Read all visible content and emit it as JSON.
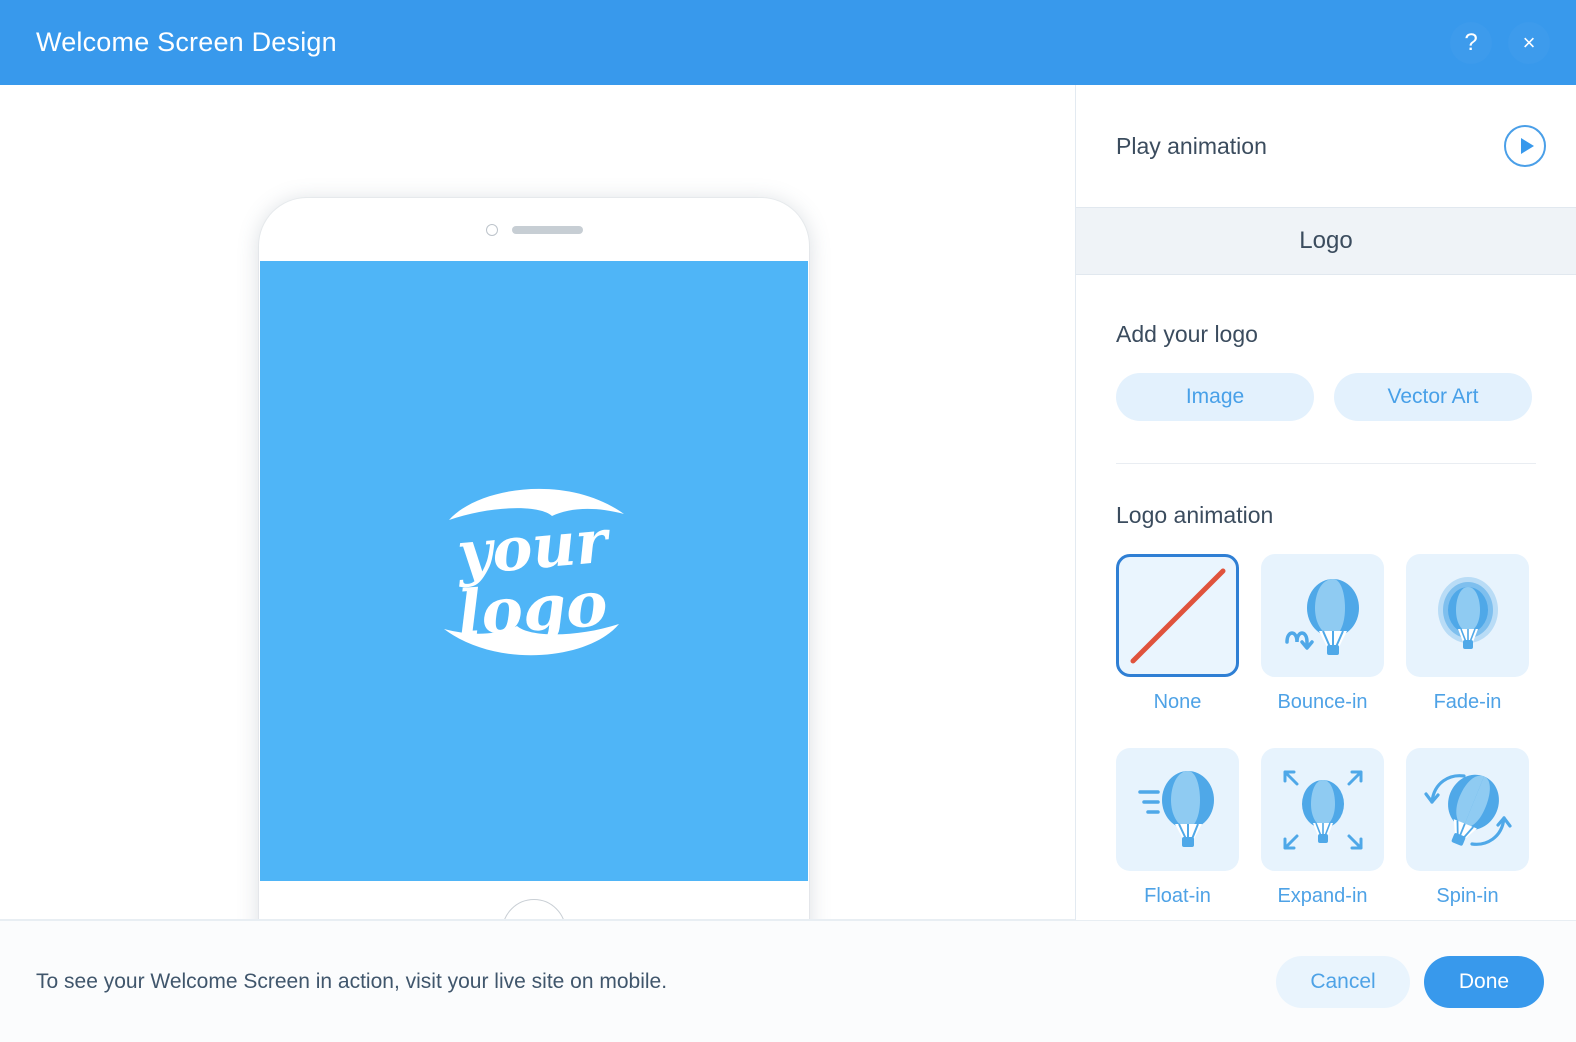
{
  "header": {
    "title": "Welcome Screen Design",
    "help_icon": "question-mark-icon",
    "help_label": "?",
    "close_icon": "close-icon",
    "close_label": "×"
  },
  "preview": {
    "device": "phone-mockup",
    "screen_color": "#4fb5f7",
    "logo_placeholder_line1": "your",
    "logo_placeholder_line2": "logo"
  },
  "panel": {
    "play_animation_label": "Play animation",
    "play_icon": "play-icon",
    "tabs": [
      {
        "label": "Logo",
        "selected": true
      }
    ],
    "add_logo": {
      "section_label": "Add your logo",
      "buttons": [
        {
          "label": "Image"
        },
        {
          "label": "Vector Art"
        }
      ]
    },
    "logo_animation": {
      "section_label": "Logo animation",
      "options": [
        {
          "label": "None",
          "icon": "no-animation-icon",
          "selected": true
        },
        {
          "label": "Bounce-in",
          "icon": "balloon-bounce-icon",
          "selected": false
        },
        {
          "label": "Fade-in",
          "icon": "balloon-fade-icon",
          "selected": false
        },
        {
          "label": "Float-in",
          "icon": "balloon-float-icon",
          "selected": false
        },
        {
          "label": "Expand-in",
          "icon": "balloon-expand-icon",
          "selected": false
        },
        {
          "label": "Spin-in",
          "icon": "balloon-spin-icon",
          "selected": false
        }
      ]
    }
  },
  "footer": {
    "note": "To see your Welcome Screen in action, visit your live site on mobile.",
    "cancel_label": "Cancel",
    "done_label": "Done"
  },
  "colors": {
    "header_blue": "#3899ec",
    "screen_blue": "#4fb5f7",
    "accent_blue": "#3899ec",
    "link_blue": "#4ea2e6",
    "tile_blue": "#e7f3fd",
    "selected_border": "#2f7fd4",
    "none_slash_red": "#e0533d",
    "text_dark": "#3b4c5e"
  }
}
